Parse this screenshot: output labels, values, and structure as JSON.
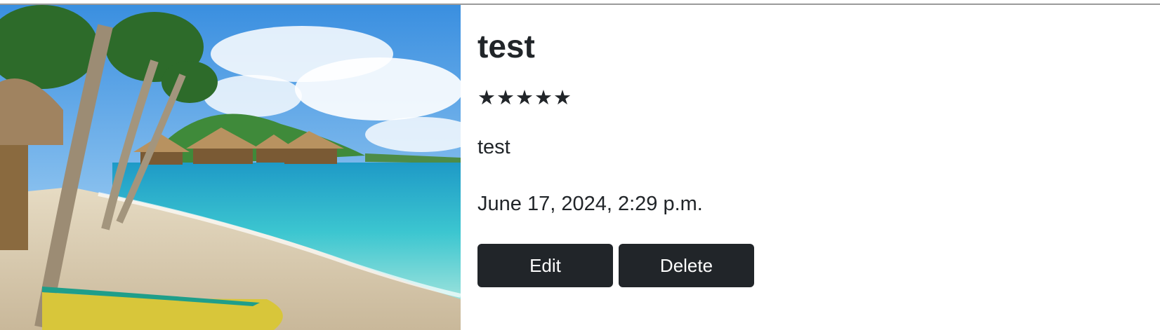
{
  "entry": {
    "title": "test",
    "rating_stars": "★★★★★",
    "rating_value": 5,
    "rating_max": 5,
    "description": "test",
    "date": "June 17, 2024, 2:29 p.m."
  },
  "actions": {
    "edit_label": "Edit",
    "delete_label": "Delete"
  },
  "colors": {
    "button_bg": "#212529",
    "text": "#212529",
    "background": "#ffffff",
    "top_rule": "#9a9a9a"
  }
}
